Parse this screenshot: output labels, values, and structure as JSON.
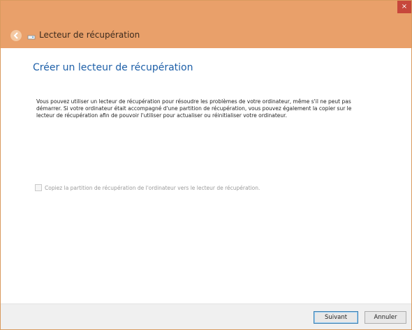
{
  "window": {
    "title": "Lecteur de récupération",
    "close_glyph": "×"
  },
  "page": {
    "heading": "Créer un lecteur de récupération",
    "description": "Vous pouvez utiliser un lecteur de récupération pour résoudre les problèmes de votre ordinateur, même s'il ne peut pas démarrer. Si votre ordinateur était accompagné d'une partition de récupération, vous pouvez également la copier sur le lecteur de récupération afin de pouvoir l'utiliser pour actualiser ou réinitialiser votre ordinateur.",
    "checkbox_label": "Copiez la partition de récupération de l'ordinateur vers le lecteur de récupération.",
    "checkbox_checked": false,
    "checkbox_enabled": false
  },
  "buttons": {
    "next": "Suivant",
    "cancel": "Annuler"
  },
  "colors": {
    "titlebar": "#e9a06a",
    "close": "#c7473b",
    "heading": "#1d5fa8"
  },
  "icons": {
    "back": "back-arrow-icon",
    "drive": "usb-drive-icon",
    "close": "close-icon"
  }
}
